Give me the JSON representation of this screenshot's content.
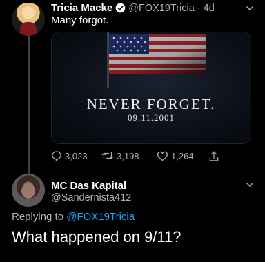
{
  "tweet": {
    "author_name": "Tricia Macke",
    "handle_time": "@FOX19Tricia · 4d",
    "text": "Many forgot.",
    "media": {
      "title": "NEVER FORGET.",
      "date": "09.11.2001"
    },
    "stats": {
      "replies": "3,023",
      "retweets": "3,198",
      "likes": "1,264"
    }
  },
  "reply": {
    "author_name": "MC Das Kapital",
    "handle": "@Sandernista412",
    "replying_prefix": "Replying to",
    "replying_mention": "@FOX19Tricia",
    "text": "What happened on 9/11?"
  },
  "colors": {
    "background": "#000000",
    "secondary_text": "#a8b3bd",
    "accent": "#1da1f2",
    "thread_line": "#38444d"
  },
  "icons": [
    "verified-badge-icon",
    "chevron-down-icon",
    "reply-icon",
    "retweet-icon",
    "heart-icon",
    "share-icon"
  ]
}
